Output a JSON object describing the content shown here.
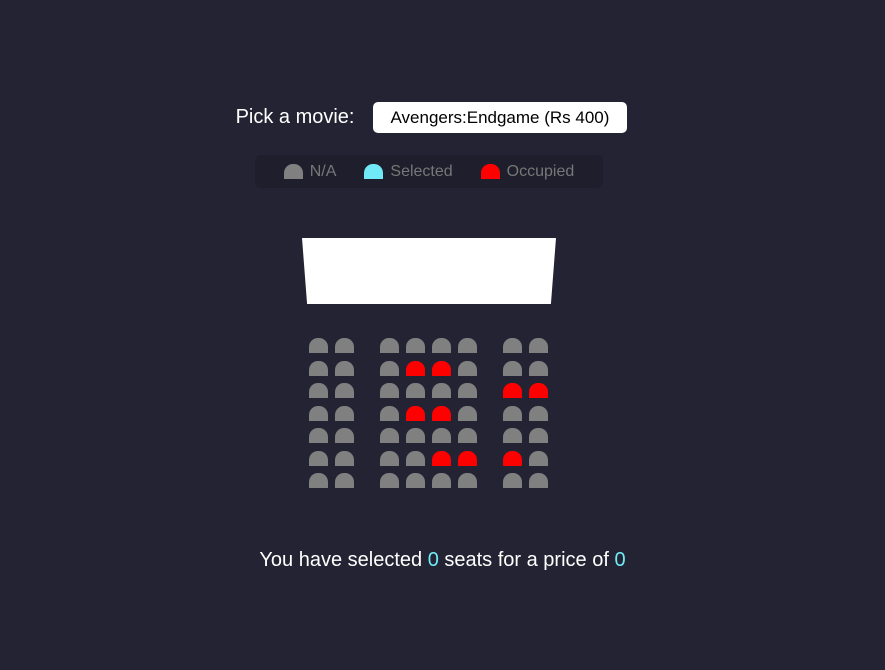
{
  "movie": {
    "label": "Pick a movie:",
    "selected_option": "Avengers:Endgame (Rs 400)"
  },
  "legend": {
    "na_label": "N/A",
    "selected_label": "Selected",
    "occupied_label": "Occupied"
  },
  "colors": {
    "background": "#242333",
    "seat_available": "#808080",
    "seat_selected": "#6feaf6",
    "seat_occupied": "#ff0000"
  },
  "seating": {
    "rows": [
      [
        "free",
        "free",
        "free",
        "free",
        "free",
        "free",
        "free",
        "free"
      ],
      [
        "free",
        "free",
        "free",
        "occupied",
        "occupied",
        "free",
        "free",
        "free"
      ],
      [
        "free",
        "free",
        "free",
        "free",
        "free",
        "free",
        "occupied",
        "occupied"
      ],
      [
        "free",
        "free",
        "free",
        "occupied",
        "occupied",
        "free",
        "free",
        "free"
      ],
      [
        "free",
        "free",
        "free",
        "free",
        "free",
        "free",
        "free",
        "free"
      ],
      [
        "free",
        "free",
        "free",
        "free",
        "occupied",
        "occupied",
        "occupied",
        "free"
      ],
      [
        "free",
        "free",
        "free",
        "free",
        "free",
        "free",
        "free",
        "free"
      ]
    ]
  },
  "summary": {
    "text_before": "You have selected ",
    "count": "0",
    "text_middle": " seats for a price of ",
    "price": "0"
  }
}
